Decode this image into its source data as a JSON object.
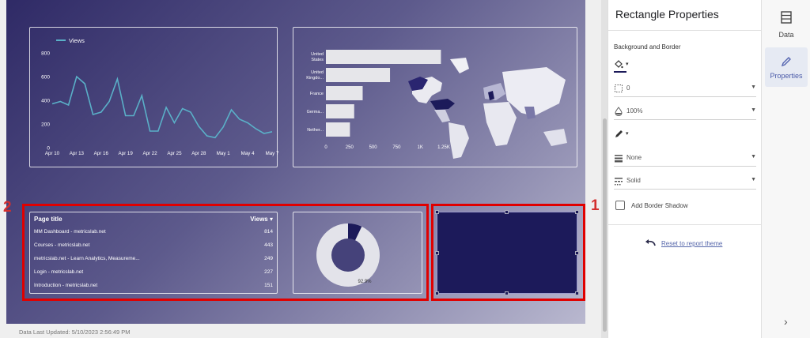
{
  "footer": {
    "last_updated": "Data Last Updated: 5/10/2023 2:56:49 PM"
  },
  "line_chart": {
    "legend": "Views",
    "y_ticks": [
      "800",
      "600",
      "400",
      "200",
      "0"
    ],
    "x_ticks": [
      "Apr 10",
      "Apr 13",
      "Apr 16",
      "Apr 19",
      "Apr 22",
      "Apr 25",
      "Apr 28",
      "May 1",
      "May 4",
      "May 7"
    ]
  },
  "bar_chart": {
    "x_ticks": [
      "0",
      "250",
      "500",
      "750",
      "1K",
      "1.25K"
    ]
  },
  "table": {
    "col_title": "Page title",
    "col_views": "Views",
    "sort_icon": "▾",
    "rows": [
      {
        "title": "MM Dashboard - metricslab.net",
        "views": "814"
      },
      {
        "title": "Courses - metricslab.net",
        "views": "443"
      },
      {
        "title": "metricslab.net - Learn Analytics, Measureme...",
        "views": "249"
      },
      {
        "title": "Login - metricslab.net",
        "views": "227"
      },
      {
        "title": "Introduction - metricslab.net",
        "views": "151"
      }
    ]
  },
  "pie": {
    "label": "92.9%"
  },
  "annotations": {
    "marker_1": "1",
    "marker_2": "2"
  },
  "properties": {
    "title": "Rectangle Properties",
    "section": "Background and Border",
    "border_radius": "0",
    "opacity": "100%",
    "border_weight": "None",
    "border_style": "Solid",
    "shadow_label": "Add Border Shadow",
    "reset_label": "Reset to report theme"
  },
  "sidetabs": {
    "data": "Data",
    "properties": "Properties"
  },
  "chart_data": [
    {
      "type": "line",
      "series": [
        {
          "name": "Views",
          "values": [
            370,
            390,
            360,
            600,
            540,
            280,
            300,
            390,
            580,
            270,
            270,
            440,
            140,
            140,
            340,
            210,
            330,
            300,
            180,
            100,
            85,
            175,
            320,
            240,
            210,
            160,
            120,
            135
          ]
        }
      ],
      "x_ticks": [
        "Apr 10",
        "Apr 13",
        "Apr 16",
        "Apr 19",
        "Apr 22",
        "Apr 25",
        "Apr 28",
        "May 1",
        "May 4",
        "May 7"
      ],
      "ylim": [
        0,
        800
      ],
      "color": "#5ab0c8"
    },
    {
      "type": "bar",
      "categories": [
        "United States",
        "United Kingdo...",
        "France",
        "Germa...",
        "Nether..."
      ],
      "values": [
        1220,
        680,
        390,
        300,
        255
      ],
      "xlim": [
        0,
        1250
      ],
      "color": "#e6e6ea"
    },
    {
      "type": "pie",
      "values": [
        92.9,
        7.1
      ],
      "colors": [
        "#e3e3ea",
        "#1c1a5a"
      ]
    }
  ]
}
